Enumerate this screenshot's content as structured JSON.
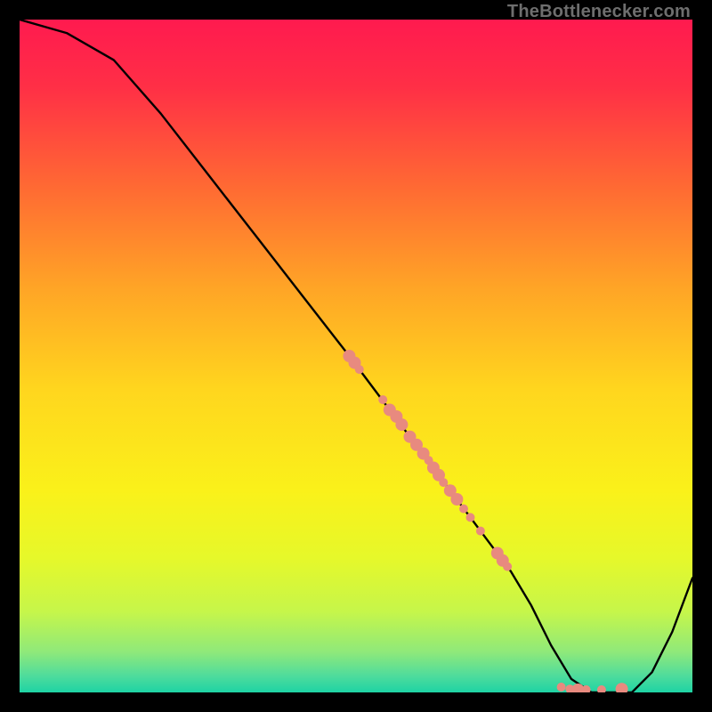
{
  "watermark": "TheBottlenecker.com",
  "chart_data": {
    "type": "line",
    "title": "",
    "xlabel": "",
    "ylabel": "",
    "xlim": [
      0,
      100
    ],
    "ylim": [
      0,
      100
    ],
    "grid": false,
    "legend": false,
    "background_gradient_stops": [
      {
        "offset": 0.0,
        "color": "#ff1a4f"
      },
      {
        "offset": 0.1,
        "color": "#ff2f46"
      },
      {
        "offset": 0.25,
        "color": "#ff6a33"
      },
      {
        "offset": 0.4,
        "color": "#ffa526"
      },
      {
        "offset": 0.55,
        "color": "#ffd61e"
      },
      {
        "offset": 0.7,
        "color": "#faf11a"
      },
      {
        "offset": 0.8,
        "color": "#e6f82a"
      },
      {
        "offset": 0.88,
        "color": "#c6f64a"
      },
      {
        "offset": 0.94,
        "color": "#8fe97a"
      },
      {
        "offset": 0.975,
        "color": "#4fdc9c"
      },
      {
        "offset": 1.0,
        "color": "#1ed3a4"
      }
    ],
    "series": [
      {
        "name": "curve",
        "x": [
          0,
          7,
          14,
          21,
          28,
          35,
          42,
          49,
          55,
          58,
          61,
          64,
          67,
          70,
          73,
          76,
          79,
          82,
          85,
          88,
          91,
          94,
          97,
          100
        ],
        "y": [
          100,
          98,
          94,
          86,
          77,
          68,
          59,
          50,
          42,
          38,
          34,
          30,
          26,
          22,
          18,
          13,
          7,
          2,
          0,
          0,
          0,
          3,
          9,
          17
        ]
      }
    ],
    "scatter_points": {
      "name": "markers",
      "color": "#e88a7f",
      "radius_major": 7,
      "radius_minor": 5,
      "points": [
        {
          "x": 49.0,
          "y": 50.0,
          "r": "major"
        },
        {
          "x": 49.8,
          "y": 49.0,
          "r": "major"
        },
        {
          "x": 50.5,
          "y": 48.0,
          "r": "minor"
        },
        {
          "x": 54.0,
          "y": 43.5,
          "r": "minor"
        },
        {
          "x": 55.0,
          "y": 42.0,
          "r": "major"
        },
        {
          "x": 56.0,
          "y": 41.0,
          "r": "major"
        },
        {
          "x": 56.8,
          "y": 39.8,
          "r": "major"
        },
        {
          "x": 58.0,
          "y": 38.0,
          "r": "major"
        },
        {
          "x": 59.0,
          "y": 36.8,
          "r": "major"
        },
        {
          "x": 60.0,
          "y": 35.5,
          "r": "major"
        },
        {
          "x": 60.8,
          "y": 34.5,
          "r": "minor"
        },
        {
          "x": 61.5,
          "y": 33.4,
          "r": "major"
        },
        {
          "x": 62.3,
          "y": 32.3,
          "r": "major"
        },
        {
          "x": 63.0,
          "y": 31.2,
          "r": "minor"
        },
        {
          "x": 64.0,
          "y": 30.0,
          "r": "major"
        },
        {
          "x": 65.0,
          "y": 28.7,
          "r": "major"
        },
        {
          "x": 66.0,
          "y": 27.3,
          "r": "minor"
        },
        {
          "x": 67.0,
          "y": 26.0,
          "r": "minor"
        },
        {
          "x": 68.5,
          "y": 24.0,
          "r": "minor"
        },
        {
          "x": 71.0,
          "y": 20.7,
          "r": "major"
        },
        {
          "x": 71.8,
          "y": 19.6,
          "r": "major"
        },
        {
          "x": 72.5,
          "y": 18.7,
          "r": "minor"
        },
        {
          "x": 80.5,
          "y": 0.8,
          "r": "minor"
        },
        {
          "x": 81.8,
          "y": 0.5,
          "r": "minor"
        },
        {
          "x": 83.0,
          "y": 0.4,
          "r": "major"
        },
        {
          "x": 84.2,
          "y": 0.4,
          "r": "minor"
        },
        {
          "x": 86.5,
          "y": 0.4,
          "r": "minor"
        },
        {
          "x": 89.5,
          "y": 0.5,
          "r": "major"
        }
      ]
    }
  }
}
